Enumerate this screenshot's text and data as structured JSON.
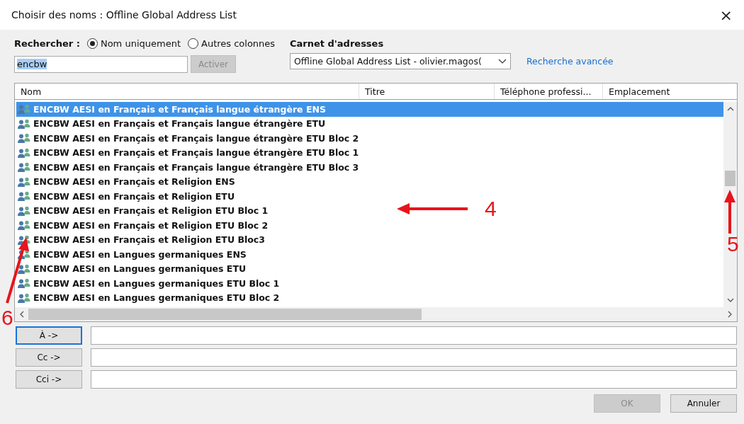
{
  "window": {
    "title": "Choisir des noms : Offline Global Address List",
    "close": "×"
  },
  "search": {
    "label": "Rechercher :",
    "options": [
      {
        "label": "Nom uniquement",
        "selected": true
      },
      {
        "label": "Autres colonnes",
        "selected": false
      }
    ],
    "value": "encbw",
    "button": {
      "label": "Activer",
      "disabled": true
    }
  },
  "address_book": {
    "label": "Carnet d'adresses",
    "value": "Offline Global Address List - olivier.magos(",
    "advanced_link": "Recherche avancée"
  },
  "table": {
    "columns": [
      "Nom",
      "Titre",
      "Téléphone professi...",
      "Emplacement"
    ],
    "rows": [
      {
        "name": "ENCBW AESI en Français et Français langue étrangère ENS",
        "selected": true
      },
      {
        "name": "ENCBW AESI en Français et Français langue étrangère ETU",
        "selected": false
      },
      {
        "name": "ENCBW AESI en Français et Français langue étrangère ETU Bloc 2",
        "selected": false
      },
      {
        "name": "ENCBW AESI en Français et Français langue étrangère ETU Bloc 1",
        "selected": false
      },
      {
        "name": "ENCBW AESI en Français et Français langue étrangère ETU Bloc 3",
        "selected": false
      },
      {
        "name": "ENCBW AESI en Français et Religion ENS",
        "selected": false
      },
      {
        "name": "ENCBW AESI en Français et Religion ETU",
        "selected": false
      },
      {
        "name": "ENCBW AESI en Français et Religion ETU Bloc 1",
        "selected": false
      },
      {
        "name": "ENCBW AESI en Français et Religion ETU Bloc 2",
        "selected": false
      },
      {
        "name": "ENCBW AESI en Français et Religion ETU Bloc3",
        "selected": false
      },
      {
        "name": "ENCBW AESI en Langues germaniques ENS",
        "selected": false
      },
      {
        "name": "ENCBW AESI en Langues germaniques ETU",
        "selected": false
      },
      {
        "name": "ENCBW AESI en Langues germaniques ETU Bloc 1",
        "selected": false
      },
      {
        "name": "ENCBW AESI en Langues germaniques ETU Bloc 2",
        "selected": false
      }
    ]
  },
  "recipients": [
    {
      "button": "À ->",
      "focused": true
    },
    {
      "button": "Cc ->",
      "focused": false
    },
    {
      "button": "Cci ->",
      "focused": false
    }
  ],
  "buttons": [
    {
      "label": "OK",
      "disabled": true
    },
    {
      "label": "Annuler",
      "disabled": false
    }
  ],
  "annotations": [
    {
      "label": "4",
      "kind": "left"
    },
    {
      "label": "5",
      "kind": "up"
    },
    {
      "label": "6",
      "kind": "upright"
    }
  ]
}
